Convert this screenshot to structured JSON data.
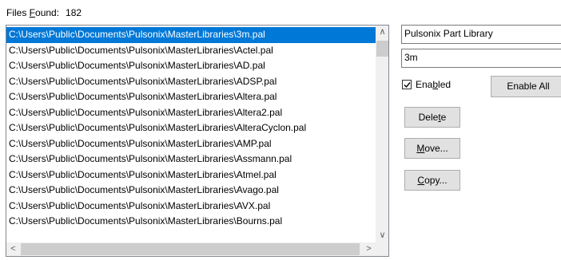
{
  "files_found": {
    "label_prefix": "Files ",
    "label_accel": "F",
    "label_suffix": "ound:",
    "count": "182"
  },
  "file_list": {
    "items": [
      "C:\\Users\\Public\\Documents\\Pulsonix\\MasterLibraries\\3m.pal",
      "C:\\Users\\Public\\Documents\\Pulsonix\\MasterLibraries\\Actel.pal",
      "C:\\Users\\Public\\Documents\\Pulsonix\\MasterLibraries\\AD.pal",
      "C:\\Users\\Public\\Documents\\Pulsonix\\MasterLibraries\\ADSP.pal",
      "C:\\Users\\Public\\Documents\\Pulsonix\\MasterLibraries\\Altera.pal",
      "C:\\Users\\Public\\Documents\\Pulsonix\\MasterLibraries\\Altera2.pal",
      "C:\\Users\\Public\\Documents\\Pulsonix\\MasterLibraries\\AlteraCyclon.pal",
      "C:\\Users\\Public\\Documents\\Pulsonix\\MasterLibraries\\AMP.pal",
      "C:\\Users\\Public\\Documents\\Pulsonix\\MasterLibraries\\Assmann.pal",
      "C:\\Users\\Public\\Documents\\Pulsonix\\MasterLibraries\\Atmel.pal",
      "C:\\Users\\Public\\Documents\\Pulsonix\\MasterLibraries\\Avago.pal",
      "C:\\Users\\Public\\Documents\\Pulsonix\\MasterLibraries\\AVX.pal",
      "C:\\Users\\Public\\Documents\\Pulsonix\\MasterLibraries\\Bourns.pal"
    ],
    "selected_index": 0
  },
  "library_name_value": "Pulsonix Part Library",
  "library_short_value": "3m",
  "enabled_checkbox": {
    "checked": true,
    "label_prefix": "Ena",
    "label_accel": "b",
    "label_suffix": "led"
  },
  "buttons": {
    "enable_all": "Enable All",
    "delete_prefix": "Dele",
    "delete_accel": "t",
    "delete_suffix": "e",
    "move_prefix": "",
    "move_accel": "M",
    "move_suffix": "ove...",
    "copy_prefix": "",
    "copy_accel": "C",
    "copy_suffix": "opy..."
  },
  "colors": {
    "selection": "#0078d7",
    "button_face": "#e1e1e1",
    "scrollbar_track": "#f0f0f0"
  }
}
